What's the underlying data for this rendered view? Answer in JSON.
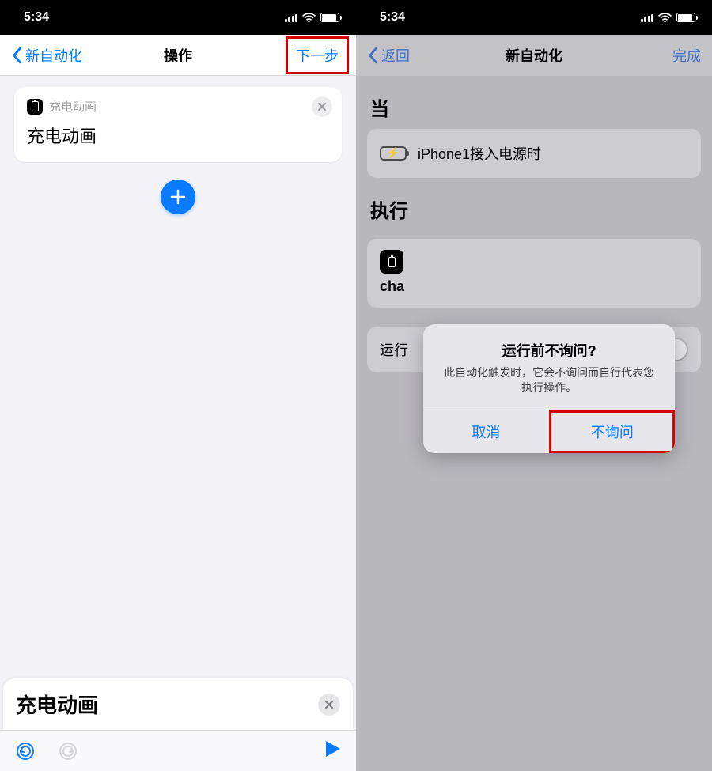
{
  "status": {
    "time": "5:34"
  },
  "left": {
    "nav": {
      "back": "新自动化",
      "title": "操作",
      "next": "下一步"
    },
    "action": {
      "smallLabel": "充电动画",
      "bigLabel": "充电动画"
    },
    "search": {
      "text": "充电动画"
    }
  },
  "right": {
    "nav": {
      "back": "返回",
      "title": "新自动化",
      "done": "完成"
    },
    "whenHeader": "当",
    "condition": "iPhone1接入电源时",
    "doHeader": "执行",
    "execLabel": "cha",
    "askRow": "运行",
    "alert": {
      "title": "运行前不询问?",
      "message": "此自动化触发时，它会不询问而自行代表您执行操作。",
      "cancel": "取消",
      "confirm": "不询问"
    }
  }
}
